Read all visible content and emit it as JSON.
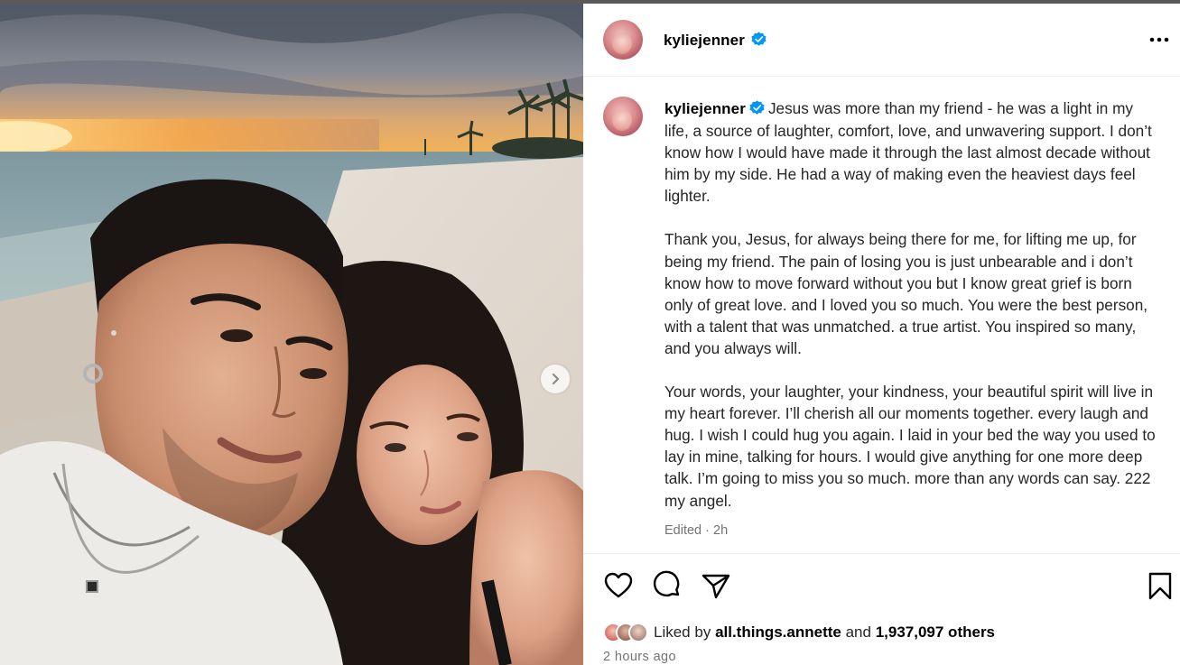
{
  "post": {
    "username": "kyliejenner",
    "verified": true,
    "caption_paragraphs": [
      "Jesus was more than my friend - he was a light in my life, a source of laughter, comfort, love, and unwavering support. I don’t know how I would have made it through the last almost decade without him by my side. He had a way of making even the heaviest days feel lighter.",
      "Thank you, Jesus, for always being there for me, for lifting me up, for being my friend. The pain of losing you is just unbearable and i don’t know how to move forward without you but I know great grief is born only of great love. and I loved you so much. You were the best person, with a talent that was unmatched. a true artist. You inspired so many, and you always will.",
      "Your words, your laughter, your kindness, your beautiful spirit will live in my heart forever. I’ll cherish all our moments together. every laugh and hug. I wish I could hug you again. I laid in your bed the way you used to lay in mine, talking for hours. I would give anything for one more deep talk. I’m going to miss you so much. more than any words can say. 222 my angel."
    ],
    "edited_label": "Edited",
    "edited_time": "2h",
    "liked_by_prefix": "Liked by",
    "liked_by_user": "all.things.annette",
    "liked_by_and": "and",
    "liked_by_count": "1,937,097 others",
    "timestamp": "2 hours ago"
  },
  "icons": {
    "verified": "verified-badge-icon",
    "more": "more-options-icon",
    "like": "heart-icon",
    "comment": "comment-icon",
    "share": "share-icon",
    "save": "bookmark-icon",
    "next": "chevron-right-icon"
  },
  "colors": {
    "verified_blue": "#0095f6",
    "muted_text": "#737373",
    "divider": "#efefef"
  }
}
